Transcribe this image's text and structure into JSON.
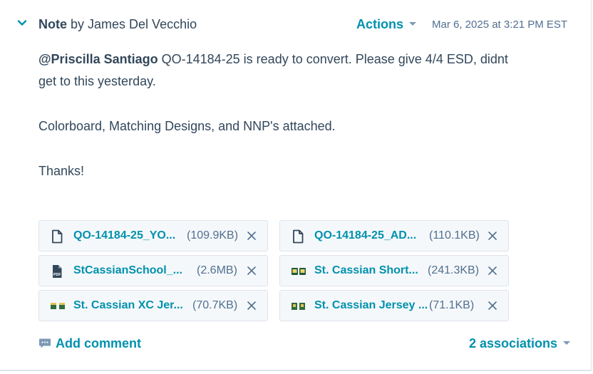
{
  "note": {
    "type_label": "Note",
    "by_label": "by James Del Vecchio",
    "actions_label": "Actions",
    "timestamp": "Mar 6, 2025 at 3:21 PM EST",
    "mention": "@Priscilla Santiago",
    "line1": " QO-14184-25 is ready to convert. Please give 4/4 ESD, didnt",
    "line2": "get to this yesterday.",
    "line3": "Colorboard, Matching Designs, and NNP's attached.",
    "line4": "Thanks!"
  },
  "attachments": [
    {
      "name": "QO-14184-25_YO...",
      "size": "(109.9KB)",
      "icon": "document-icon"
    },
    {
      "name": "QO-14184-25_AD...",
      "size": "(110.1KB)",
      "icon": "document-icon"
    },
    {
      "name": "StCassianSchool_...",
      "size": "(2.6MB)",
      "icon": "pdf-icon"
    },
    {
      "name": "St. Cassian Short...",
      "size": "(241.3KB)",
      "icon": "image-thumbnail-icon"
    },
    {
      "name": "St. Cassian XC Jer...",
      "size": "(70.7KB)",
      "icon": "image-thumbnail-icon"
    },
    {
      "name": "St. Cassian Jersey ...",
      "size": "(71.1KB)",
      "icon": "image-thumbnail-icon"
    }
  ],
  "footer": {
    "add_comment_label": "Add comment",
    "associations_label": "2 associations"
  },
  "colors": {
    "link": "#0091ae",
    "text": "#33475b",
    "muted": "#516f90",
    "attachment_bg": "#f5f8fa",
    "border": "#dfe3eb"
  }
}
